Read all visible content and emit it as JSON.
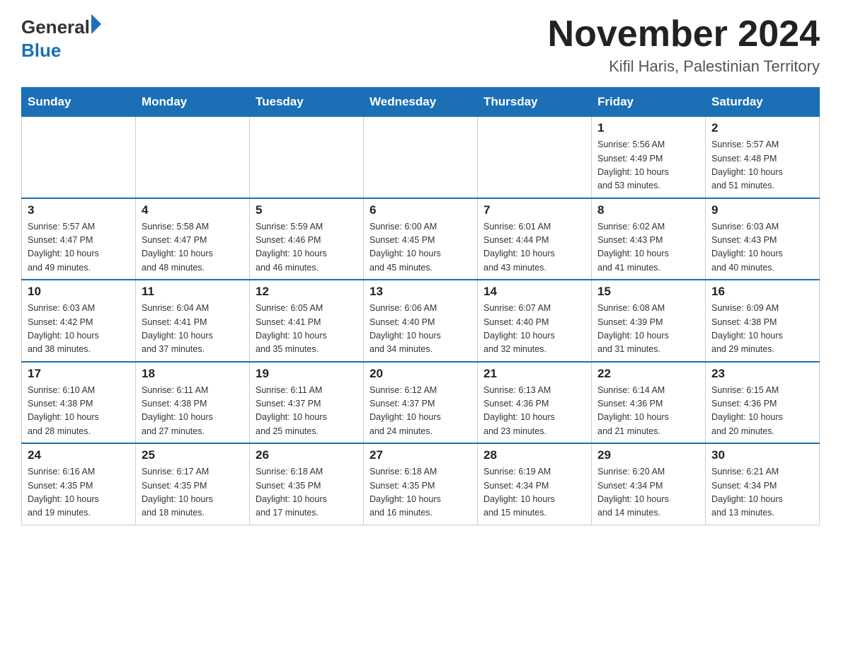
{
  "header": {
    "logo_general": "General",
    "logo_blue": "Blue",
    "month_year": "November 2024",
    "location": "Kifil Haris, Palestinian Territory"
  },
  "days_of_week": [
    "Sunday",
    "Monday",
    "Tuesday",
    "Wednesday",
    "Thursday",
    "Friday",
    "Saturday"
  ],
  "weeks": [
    [
      {
        "day": "",
        "info": ""
      },
      {
        "day": "",
        "info": ""
      },
      {
        "day": "",
        "info": ""
      },
      {
        "day": "",
        "info": ""
      },
      {
        "day": "",
        "info": ""
      },
      {
        "day": "1",
        "info": "Sunrise: 5:56 AM\nSunset: 4:49 PM\nDaylight: 10 hours\nand 53 minutes."
      },
      {
        "day": "2",
        "info": "Sunrise: 5:57 AM\nSunset: 4:48 PM\nDaylight: 10 hours\nand 51 minutes."
      }
    ],
    [
      {
        "day": "3",
        "info": "Sunrise: 5:57 AM\nSunset: 4:47 PM\nDaylight: 10 hours\nand 49 minutes."
      },
      {
        "day": "4",
        "info": "Sunrise: 5:58 AM\nSunset: 4:47 PM\nDaylight: 10 hours\nand 48 minutes."
      },
      {
        "day": "5",
        "info": "Sunrise: 5:59 AM\nSunset: 4:46 PM\nDaylight: 10 hours\nand 46 minutes."
      },
      {
        "day": "6",
        "info": "Sunrise: 6:00 AM\nSunset: 4:45 PM\nDaylight: 10 hours\nand 45 minutes."
      },
      {
        "day": "7",
        "info": "Sunrise: 6:01 AM\nSunset: 4:44 PM\nDaylight: 10 hours\nand 43 minutes."
      },
      {
        "day": "8",
        "info": "Sunrise: 6:02 AM\nSunset: 4:43 PM\nDaylight: 10 hours\nand 41 minutes."
      },
      {
        "day": "9",
        "info": "Sunrise: 6:03 AM\nSunset: 4:43 PM\nDaylight: 10 hours\nand 40 minutes."
      }
    ],
    [
      {
        "day": "10",
        "info": "Sunrise: 6:03 AM\nSunset: 4:42 PM\nDaylight: 10 hours\nand 38 minutes."
      },
      {
        "day": "11",
        "info": "Sunrise: 6:04 AM\nSunset: 4:41 PM\nDaylight: 10 hours\nand 37 minutes."
      },
      {
        "day": "12",
        "info": "Sunrise: 6:05 AM\nSunset: 4:41 PM\nDaylight: 10 hours\nand 35 minutes."
      },
      {
        "day": "13",
        "info": "Sunrise: 6:06 AM\nSunset: 4:40 PM\nDaylight: 10 hours\nand 34 minutes."
      },
      {
        "day": "14",
        "info": "Sunrise: 6:07 AM\nSunset: 4:40 PM\nDaylight: 10 hours\nand 32 minutes."
      },
      {
        "day": "15",
        "info": "Sunrise: 6:08 AM\nSunset: 4:39 PM\nDaylight: 10 hours\nand 31 minutes."
      },
      {
        "day": "16",
        "info": "Sunrise: 6:09 AM\nSunset: 4:38 PM\nDaylight: 10 hours\nand 29 minutes."
      }
    ],
    [
      {
        "day": "17",
        "info": "Sunrise: 6:10 AM\nSunset: 4:38 PM\nDaylight: 10 hours\nand 28 minutes."
      },
      {
        "day": "18",
        "info": "Sunrise: 6:11 AM\nSunset: 4:38 PM\nDaylight: 10 hours\nand 27 minutes."
      },
      {
        "day": "19",
        "info": "Sunrise: 6:11 AM\nSunset: 4:37 PM\nDaylight: 10 hours\nand 25 minutes."
      },
      {
        "day": "20",
        "info": "Sunrise: 6:12 AM\nSunset: 4:37 PM\nDaylight: 10 hours\nand 24 minutes."
      },
      {
        "day": "21",
        "info": "Sunrise: 6:13 AM\nSunset: 4:36 PM\nDaylight: 10 hours\nand 23 minutes."
      },
      {
        "day": "22",
        "info": "Sunrise: 6:14 AM\nSunset: 4:36 PM\nDaylight: 10 hours\nand 21 minutes."
      },
      {
        "day": "23",
        "info": "Sunrise: 6:15 AM\nSunset: 4:36 PM\nDaylight: 10 hours\nand 20 minutes."
      }
    ],
    [
      {
        "day": "24",
        "info": "Sunrise: 6:16 AM\nSunset: 4:35 PM\nDaylight: 10 hours\nand 19 minutes."
      },
      {
        "day": "25",
        "info": "Sunrise: 6:17 AM\nSunset: 4:35 PM\nDaylight: 10 hours\nand 18 minutes."
      },
      {
        "day": "26",
        "info": "Sunrise: 6:18 AM\nSunset: 4:35 PM\nDaylight: 10 hours\nand 17 minutes."
      },
      {
        "day": "27",
        "info": "Sunrise: 6:18 AM\nSunset: 4:35 PM\nDaylight: 10 hours\nand 16 minutes."
      },
      {
        "day": "28",
        "info": "Sunrise: 6:19 AM\nSunset: 4:34 PM\nDaylight: 10 hours\nand 15 minutes."
      },
      {
        "day": "29",
        "info": "Sunrise: 6:20 AM\nSunset: 4:34 PM\nDaylight: 10 hours\nand 14 minutes."
      },
      {
        "day": "30",
        "info": "Sunrise: 6:21 AM\nSunset: 4:34 PM\nDaylight: 10 hours\nand 13 minutes."
      }
    ]
  ]
}
